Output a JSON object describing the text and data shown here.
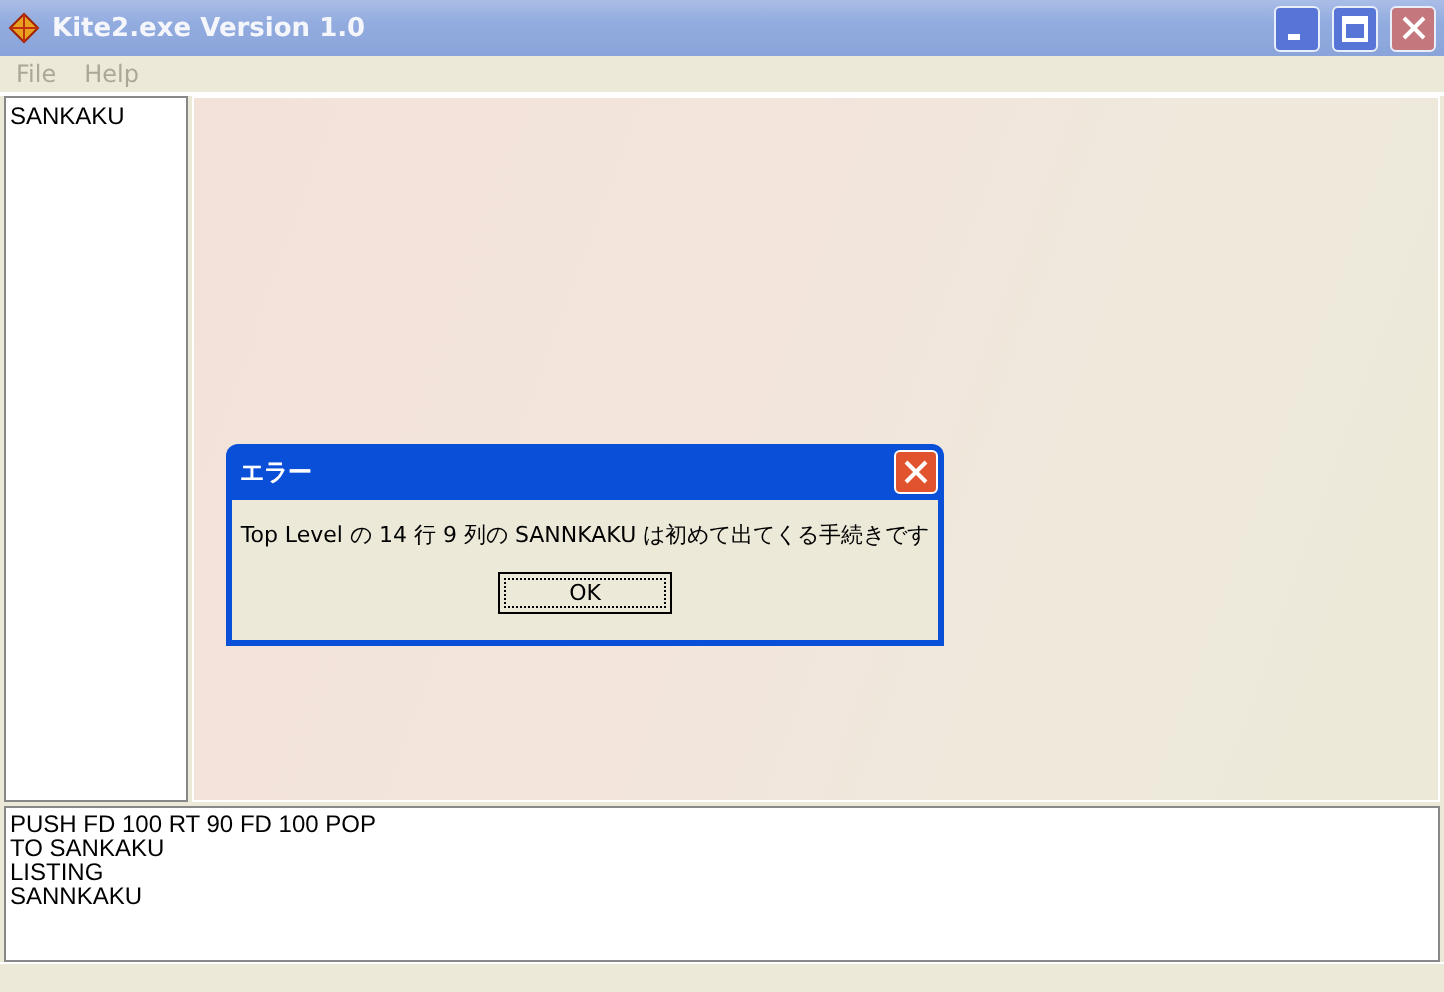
{
  "window": {
    "title": "Kite2.exe Version 1.0"
  },
  "menu": [
    {
      "label": "File",
      "disabled": true
    },
    {
      "label": "Help",
      "disabled": true
    }
  ],
  "procedure_list": {
    "items": [
      "SANKAKU"
    ]
  },
  "console": {
    "lines": [
      "PUSH FD 100 RT 90 FD 100 POP",
      "TO SANKAKU",
      "LISTING",
      "SANNKAKU"
    ]
  },
  "dialog": {
    "title": "エラー",
    "message": "Top Level の 14 行 9 列の SANNKAKU は初めて出てくる手続きです",
    "buttons": [
      "OK"
    ]
  }
}
